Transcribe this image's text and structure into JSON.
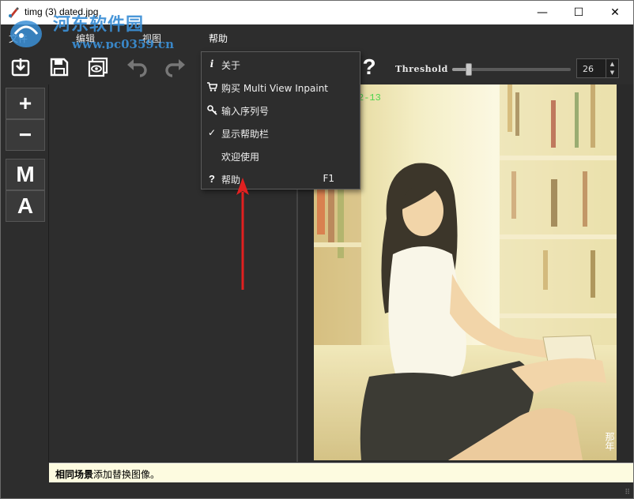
{
  "window": {
    "title": "timg (3) dated.jpg",
    "minimize_glyph": "—",
    "maximize_glyph": "☐",
    "close_glyph": "✕"
  },
  "watermark": {
    "site_name": "河东软件园",
    "url": "www.pc0359.cn"
  },
  "menubar": {
    "items": [
      {
        "label": "文件"
      },
      {
        "label": "编辑"
      },
      {
        "label": "视图"
      },
      {
        "label": "帮助"
      }
    ]
  },
  "toolbar": {
    "threshold_label": "Threshold",
    "threshold_value": "26",
    "threshold_fraction": 0.14,
    "help_glyph": "?"
  },
  "tools": {
    "plus": "+",
    "minus": "−",
    "mode_m": "M",
    "mode_a": "A"
  },
  "dropdown": {
    "items": [
      {
        "icon": "info-icon",
        "glyph": "i",
        "label": "关于",
        "shortcut": ""
      },
      {
        "icon": "cart-icon",
        "glyph": "🛒",
        "label": "购买 Multi View Inpaint",
        "shortcut": ""
      },
      {
        "icon": "key-icon",
        "glyph": "⚷",
        "label": "输入序列号",
        "shortcut": ""
      },
      {
        "icon": "checkmark-icon",
        "glyph": "✓",
        "label": "显示帮助栏",
        "shortcut": ""
      },
      {
        "icon": "",
        "glyph": "",
        "label": "欢迎使用",
        "shortcut": ""
      },
      {
        "icon": "question-icon",
        "glyph": "?",
        "label": "帮助",
        "shortcut": "F1"
      }
    ]
  },
  "photo": {
    "date_stamp": "2-13",
    "signature": "那年"
  },
  "status": {
    "bold_text": "相同场景",
    "text": "添加替换图像。"
  },
  "colors": {
    "accent_arrow": "#e02020",
    "status_bg": "#fdfbe0",
    "watermark_blue": "#3b8fd6"
  }
}
